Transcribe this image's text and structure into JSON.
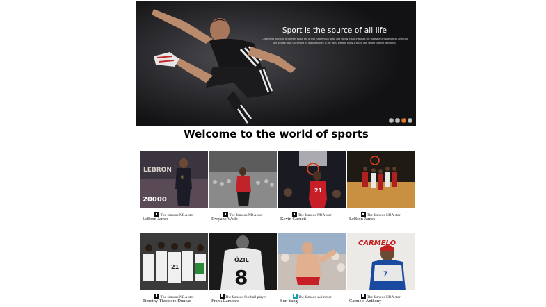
{
  "hero": {
    "title": "Sport is the source of all life",
    "description": "Long-term physical problems make the bright future with dark, and strong vitality makes the ultimate circumstances also can get golden light.Corrosion of human nature is the most terrible thing a sport, and sports is most predators"
  },
  "heading": "Welcome to the world of sports",
  "cards": [
    {
      "caption": "The famous NBA star",
      "name": "LeBron James",
      "overlay_text": "LEBRON 20000",
      "icon": "image-icon"
    },
    {
      "caption": "The famous NBA star",
      "name": "Dwyane Wade",
      "overlay_text": "",
      "icon": "image-icon"
    },
    {
      "caption": "The famous NBA star",
      "name": "Kevin Garnett",
      "overlay_text": "",
      "icon": "image-icon"
    },
    {
      "caption": "The famous NBA star",
      "name": "LeBron James",
      "overlay_text": "",
      "icon": "image-icon"
    },
    {
      "caption": "The famous NBA star",
      "name": "Timothy Theodore Duncan",
      "overlay_text": "",
      "icon": "image-icon"
    },
    {
      "caption": "The famous football player",
      "name": "Frank Lampard",
      "overlay_text": "ÖZIL 8",
      "icon": "image-icon"
    },
    {
      "caption": "The famous swimmer",
      "name": "Sun Yang",
      "overlay_text": "",
      "icon": "image-icon"
    },
    {
      "caption": "The famous NBA star",
      "name": "Carmelo Anthony",
      "overlay_text": "CARMELO",
      "icon": "image-icon"
    }
  ],
  "slider": {
    "dot_count": 4,
    "active_index": 2
  }
}
